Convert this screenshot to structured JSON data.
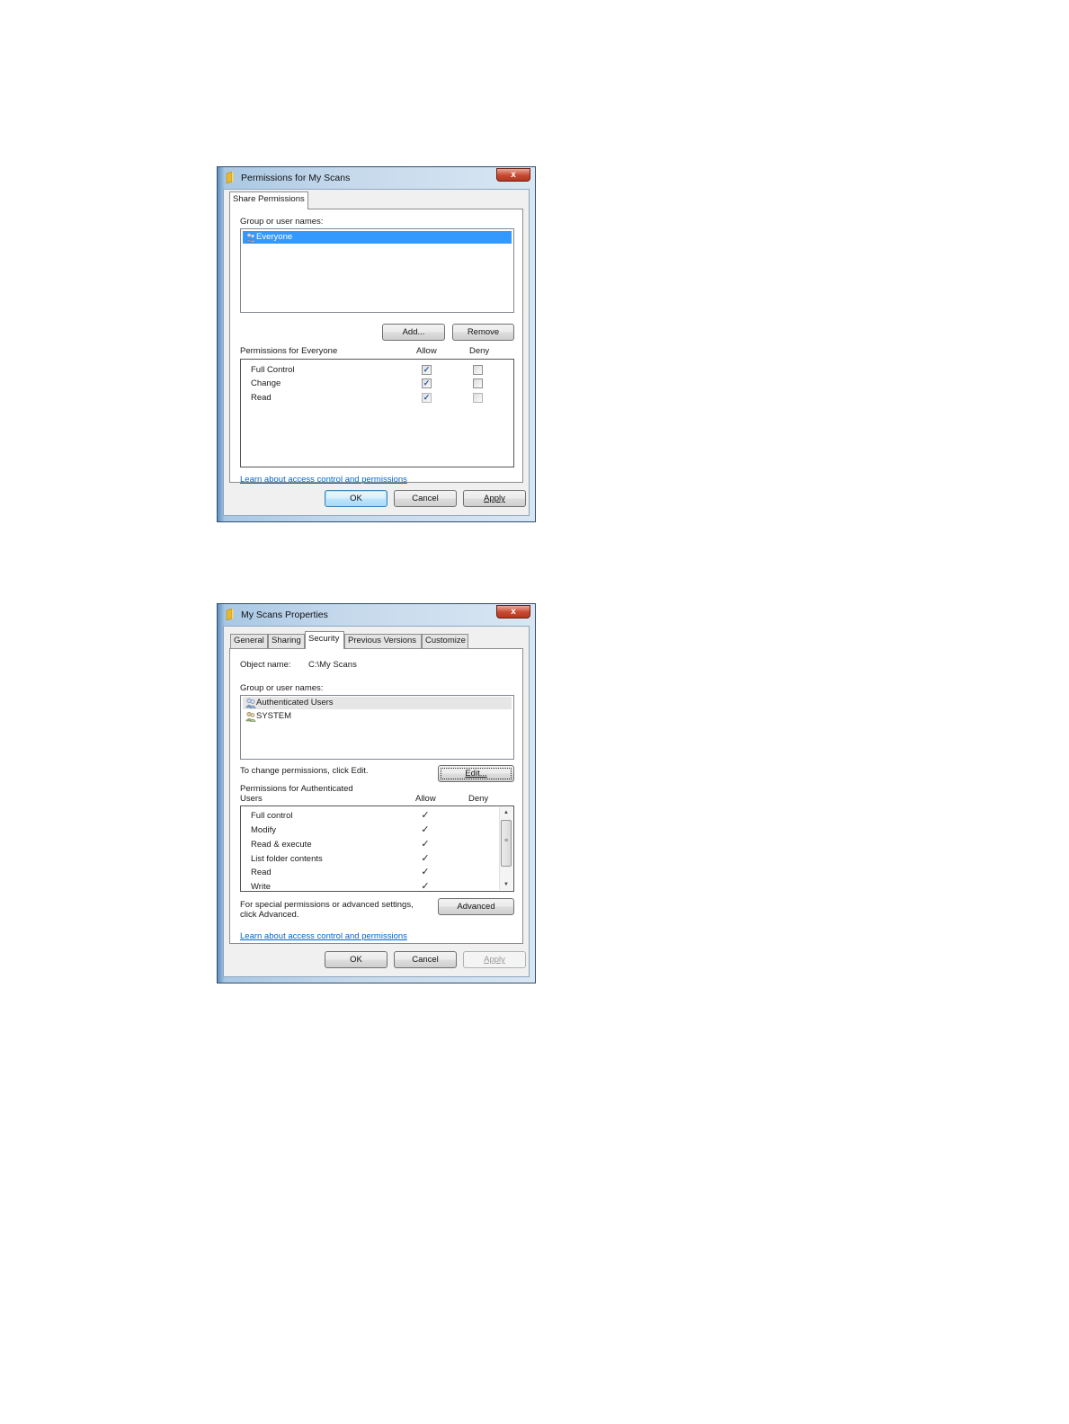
{
  "colors": {
    "selection": "#3399ff",
    "link": "#0066cc",
    "frame": "#2e4d70",
    "close": "#c8472f"
  },
  "icons": {
    "folder": "folder-icon",
    "user_group": "user-group-icon",
    "close": "close-icon",
    "check": "checkmark-icon"
  },
  "share_dialog": {
    "title": "Permissions for My Scans",
    "close_label": "x",
    "tab": "Share Permissions",
    "group_label": "Group or user names:",
    "users": [
      {
        "name": "Everyone",
        "selected": true
      }
    ],
    "add_button": "Add...",
    "remove_button": "Remove",
    "perms_label": "Permissions for Everyone",
    "allow_header": "Allow",
    "deny_header": "Deny",
    "permissions": [
      {
        "name": "Full Control",
        "allow": true,
        "deny": false
      },
      {
        "name": "Change",
        "allow": true,
        "deny": false
      },
      {
        "name": "Read",
        "allow": true,
        "deny": false
      }
    ],
    "check_glyph": "✓",
    "link": "Learn about access control and permissions",
    "ok_button": "OK",
    "cancel_button": "Cancel",
    "apply_button": "Apply"
  },
  "props_dialog": {
    "title": "My Scans Properties",
    "close_label": "x",
    "tabs": [
      "General",
      "Sharing",
      "Security",
      "Previous Versions",
      "Customize"
    ],
    "active_tab": "Security",
    "object_label": "Object name:",
    "object_value": "C:\\My Scans",
    "group_label": "Group or user names:",
    "users": [
      {
        "name": "Authenticated Users",
        "selected": true
      },
      {
        "name": "SYSTEM",
        "selected": false
      }
    ],
    "change_text": "To change permissions, click Edit.",
    "edit_button": "Edit...",
    "perms_label_line1": "Permissions for Authenticated",
    "perms_label_line2": "Users",
    "allow_header": "Allow",
    "deny_header": "Deny",
    "permissions": [
      {
        "name": "Full control",
        "allow": true,
        "deny": false
      },
      {
        "name": "Modify",
        "allow": true,
        "deny": false
      },
      {
        "name": "Read & execute",
        "allow": true,
        "deny": false
      },
      {
        "name": "List folder contents",
        "allow": true,
        "deny": false
      },
      {
        "name": "Read",
        "allow": true,
        "deny": false
      },
      {
        "name": "Write",
        "allow": true,
        "deny": false
      }
    ],
    "check_glyph": "✓",
    "special_line1": "For special permissions or advanced settings,",
    "special_line2": "click Advanced.",
    "advanced_button": "Advanced",
    "link": "Learn about access control and permissions",
    "ok_button": "OK",
    "cancel_button": "Cancel",
    "apply_button": "Apply"
  }
}
